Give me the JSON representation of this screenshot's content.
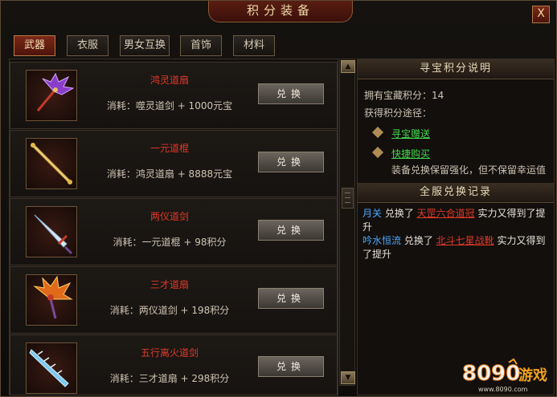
{
  "window": {
    "title": "积分装备",
    "close_label": "X"
  },
  "tabs": [
    {
      "label": "武器",
      "active": true
    },
    {
      "label": "衣服",
      "active": false
    },
    {
      "label": "男女互换",
      "active": false
    },
    {
      "label": "首饰",
      "active": false
    },
    {
      "label": "材料",
      "active": false
    }
  ],
  "items": [
    {
      "name": "鸿灵道扇",
      "cost": "消耗：噬灵道剑 + 1000元宝",
      "button": "兑换",
      "icon": "purple-fan-icon"
    },
    {
      "name": "一元道棍",
      "cost": "消耗：鸿灵道扇 + 8888元宝",
      "button": "兑换",
      "icon": "golden-staff-icon"
    },
    {
      "name": "两仪道剑",
      "cost": "消耗：一元道棍 + 98积分",
      "button": "兑换",
      "icon": "ice-sword-icon"
    },
    {
      "name": "三才道扇",
      "cost": "消耗：两仪道剑 + 198积分",
      "button": "兑换",
      "icon": "fire-fan-icon"
    },
    {
      "name": "五行离火道剑",
      "cost": "消耗：三才道扇 + 298积分",
      "button": "兑换",
      "icon": "crystal-sword-icon"
    }
  ],
  "scrollbar": {
    "up": "▲",
    "down": "▼"
  },
  "info": {
    "header": "寻宝积分说明",
    "points_line": "拥有宝藏积分：14",
    "ways_title": "获得积分途径：",
    "ways": [
      "寻宝赠送",
      "快捷购买"
    ],
    "note": "装备兑换保留强化，但不保留幸运值"
  },
  "records": {
    "header": "全服兑换记录",
    "entries": [
      {
        "player": "月关",
        "verb": " 兑换了 ",
        "item": "天罡六合道冠",
        "suffix": " 实力又得到了提升"
      },
      {
        "player": "吟水恒流",
        "verb": " 兑换了 ",
        "item": "北斗七星战靴",
        "suffix": " 实力又得到了提升"
      }
    ]
  },
  "logo": {
    "text": "8090游戏",
    "url_text": "www.8090.com"
  },
  "colors": {
    "accent_red": "#e03a2a",
    "link_green": "#43d64a",
    "player_blue": "#4aa7ff"
  }
}
